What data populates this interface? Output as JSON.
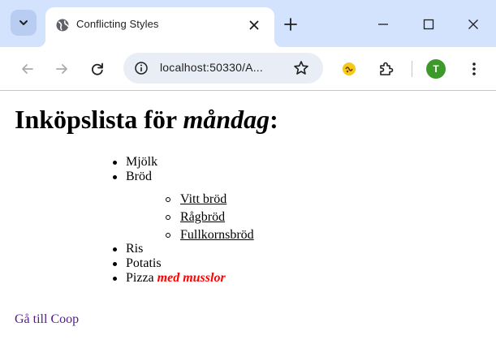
{
  "browser": {
    "tab_title": "Conflicting Styles",
    "url": "localhost:50330/A...",
    "profile_initial": "T",
    "icons": [
      "chevron-down-icon",
      "globe-icon",
      "close-icon",
      "plus-icon",
      "minimize-icon",
      "maximize-icon",
      "back-icon",
      "forward-icon",
      "reload-icon",
      "info-icon",
      "star-icon",
      "extension-icon",
      "puzzle-icon",
      "kebab-menu-icon"
    ],
    "colors": {
      "tabstrip": "#d3e3fd",
      "omnibox": "#e9eef6",
      "avatar": "#3d9a2a"
    }
  },
  "page": {
    "heading_prefix": "Inköpslista för ",
    "heading_emphasis": "måndag",
    "heading_suffix": ":",
    "items": [
      "Mjölk",
      "Bröd",
      "Ris",
      "Potatis"
    ],
    "pizza_label": "Pizza ",
    "pizza_topping": "med musslor",
    "bread_types": [
      "Vitt bröd",
      "Rågbröd",
      "Fullkornsbröd"
    ],
    "link_text": "Gå till Coop",
    "colors": {
      "topping": "#ff0000",
      "visited_link": "#551a8b"
    }
  }
}
